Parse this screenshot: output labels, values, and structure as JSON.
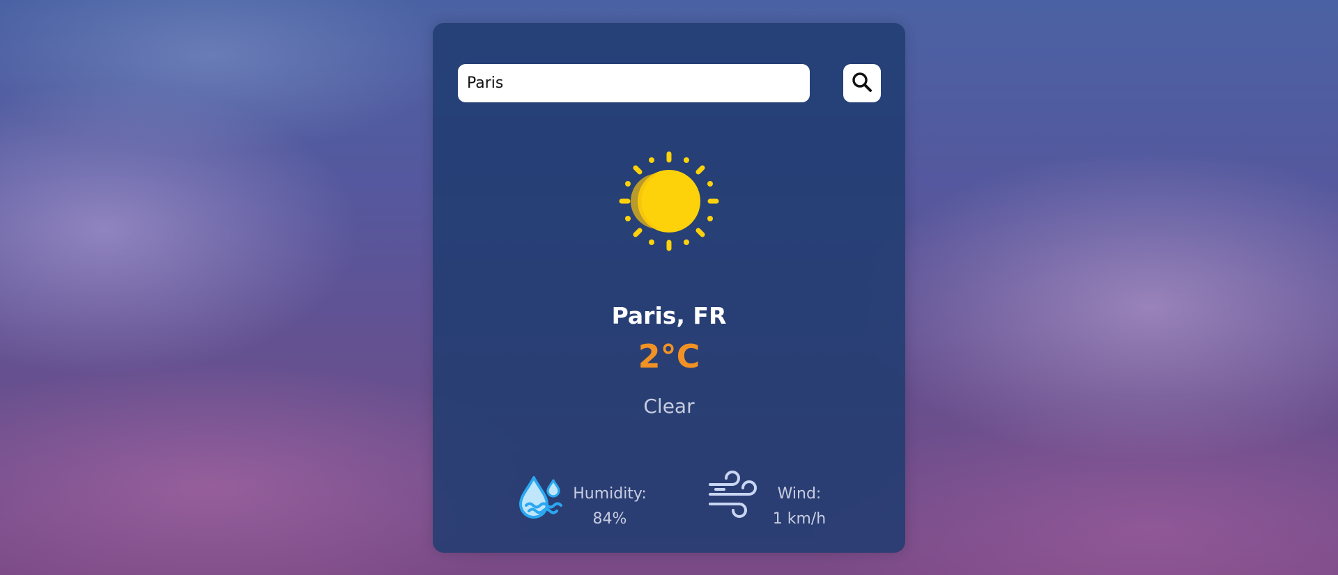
{
  "search": {
    "value": "Paris",
    "placeholder": ""
  },
  "weather": {
    "icon": "sun-icon",
    "location": "Paris, FR",
    "temperature": "2°C",
    "condition": "Clear"
  },
  "stats": {
    "humidity": {
      "icon": "humidity-icon",
      "label": "Humidity:",
      "value": "84%"
    },
    "wind": {
      "icon": "wind-icon",
      "label": "Wind:",
      "value": "1 km/h"
    }
  },
  "colors": {
    "card_background": "#1e3c70",
    "temperature": "#f39224",
    "sun": "#fdd20a",
    "humidity_icon": "#2ba7f0",
    "wind_icon": "#c9d6f2"
  }
}
